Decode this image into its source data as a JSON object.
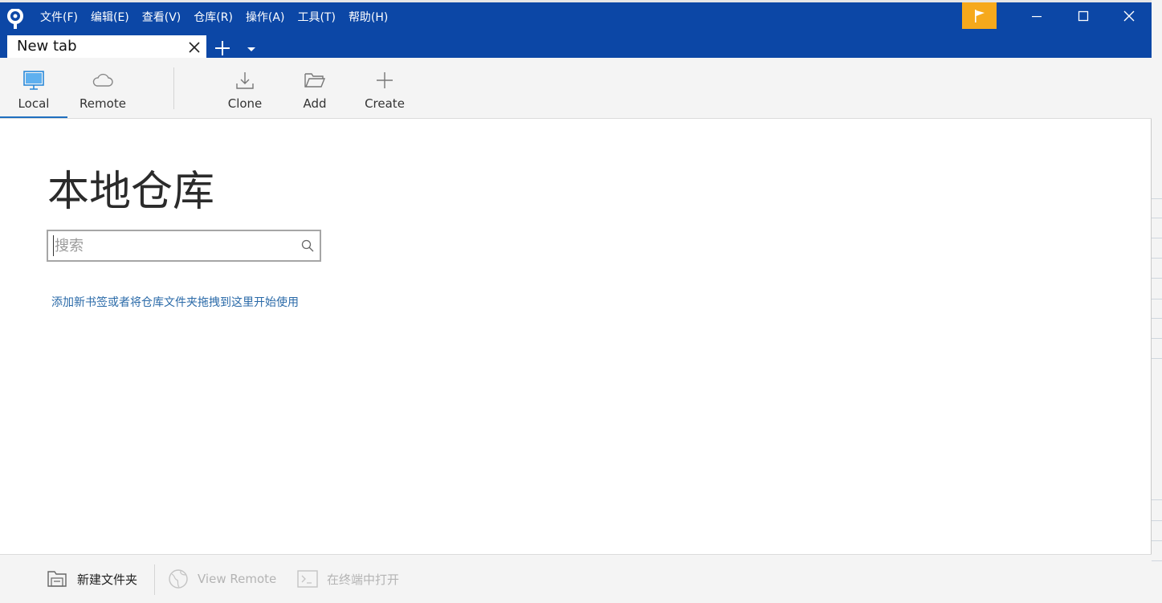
{
  "menu": {
    "items": [
      "文件(F)",
      "编辑(E)",
      "查看(V)",
      "仓库(R)",
      "操作(A)",
      "工具(T)",
      "帮助(H)"
    ]
  },
  "tabs": [
    {
      "label": "New tab"
    }
  ],
  "toolbar": {
    "local_label": "Local",
    "remote_label": "Remote",
    "clone_label": "Clone",
    "add_label": "Add",
    "create_label": "Create"
  },
  "main": {
    "title": "本地仓库",
    "search_placeholder": "搜索",
    "search_value": "",
    "hint": "添加新书签或者将仓库文件夹拖拽到这里开始使用"
  },
  "bottombar": {
    "new_folder_label": "新建文件夹",
    "view_remote_label": "View Remote",
    "open_terminal_label": "在终端中打开"
  },
  "colors": {
    "titlebar": "#0c47a6",
    "accent": "#1f6fbf",
    "flag": "#f6a91c",
    "hint_link": "#2a6aa8"
  }
}
